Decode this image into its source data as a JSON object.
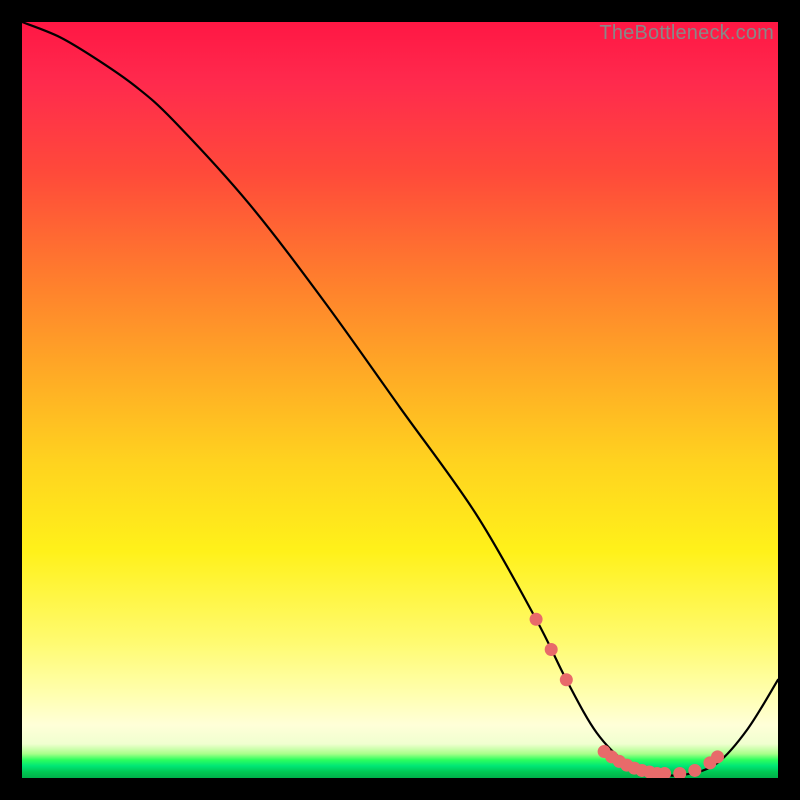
{
  "watermark": "TheBottleneck.com",
  "chart_data": {
    "type": "line",
    "title": "",
    "xlabel": "",
    "ylabel": "",
    "xlim": [
      0,
      100
    ],
    "ylim": [
      0,
      100
    ],
    "series": [
      {
        "name": "curve",
        "x": [
          0,
          5,
          10,
          15,
          20,
          30,
          40,
          50,
          60,
          68,
          72,
          76,
          80,
          84,
          88,
          92,
          96,
          100
        ],
        "y": [
          100,
          98,
          95,
          91.5,
          87,
          76,
          63,
          49,
          35,
          21,
          13,
          6,
          2,
          0.5,
          0.5,
          2,
          6.5,
          13
        ]
      }
    ],
    "markers": {
      "name": "highlight-points",
      "color": "#e86a6a",
      "x": [
        68,
        70,
        72,
        77,
        78,
        79,
        80,
        81,
        82,
        83,
        84,
        85,
        87,
        89,
        91,
        92
      ],
      "y": [
        21,
        17,
        13,
        3.5,
        2.8,
        2.2,
        1.7,
        1.3,
        1.0,
        0.8,
        0.6,
        0.6,
        0.6,
        1.0,
        2.0,
        2.8
      ]
    }
  }
}
